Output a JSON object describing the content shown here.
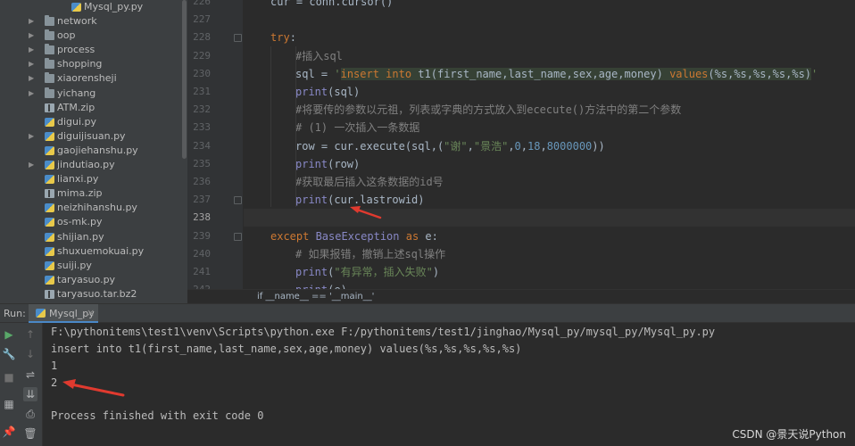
{
  "project_tree": {
    "top_item": "Mysql_py.py",
    "items": [
      {
        "label": "network",
        "type": "folder",
        "expandable": true
      },
      {
        "label": "oop",
        "type": "folder",
        "expandable": true
      },
      {
        "label": "process",
        "type": "folder",
        "expandable": true
      },
      {
        "label": "shopping",
        "type": "folder",
        "expandable": true
      },
      {
        "label": "xiaorensheji",
        "type": "folder",
        "expandable": true
      },
      {
        "label": "yichang",
        "type": "folder",
        "expandable": true
      },
      {
        "label": "ATM.zip",
        "type": "zip",
        "expandable": false
      },
      {
        "label": "digui.py",
        "type": "py",
        "expandable": false
      },
      {
        "label": "diguijisuan.py",
        "type": "py",
        "expandable": true
      },
      {
        "label": "gaojiehanshu.py",
        "type": "py",
        "expandable": false
      },
      {
        "label": "jindutiao.py",
        "type": "py",
        "expandable": true
      },
      {
        "label": "lianxi.py",
        "type": "py",
        "expandable": false
      },
      {
        "label": "mima.zip",
        "type": "zip",
        "expandable": false
      },
      {
        "label": "neizhihanshu.py",
        "type": "py",
        "expandable": false
      },
      {
        "label": "os-mk.py",
        "type": "py",
        "expandable": false
      },
      {
        "label": "shijian.py",
        "type": "py",
        "expandable": false
      },
      {
        "label": "shuxuemokuai.py",
        "type": "py",
        "expandable": false
      },
      {
        "label": "suiji.py",
        "type": "py",
        "expandable": false
      },
      {
        "label": "taryasuo.py",
        "type": "py",
        "expandable": false
      },
      {
        "label": "taryasuo.tar.bz2",
        "type": "zip",
        "expandable": false
      }
    ]
  },
  "editor": {
    "lines": [
      {
        "num": "226",
        "indent": 1,
        "tokens": [
          {
            "t": "cur = conn.cursor()",
            "c": ""
          }
        ]
      },
      {
        "num": "227",
        "indent": 0,
        "tokens": []
      },
      {
        "num": "228",
        "indent": 1,
        "fold": true,
        "tokens": [
          {
            "t": "try",
            "c": "kw"
          },
          {
            "t": ":",
            "c": ""
          }
        ]
      },
      {
        "num": "229",
        "indent": 2,
        "tokens": [
          {
            "t": "#插入sql",
            "c": "cmt"
          }
        ]
      },
      {
        "num": "230",
        "indent": 2,
        "tokens": [
          {
            "t": "sql = ",
            "c": ""
          },
          {
            "t": "'",
            "c": "str"
          },
          {
            "t": "insert into",
            "c": "sqlkw sqlbg"
          },
          {
            "t": " t1(first_name,last_name,sex,age,money) ",
            "c": "sqlbg"
          },
          {
            "t": "values",
            "c": "sqlkw sqlbg"
          },
          {
            "t": "(%s,%s,%s,%s,%s)",
            "c": "sqlbg"
          },
          {
            "t": "'",
            "c": "str"
          }
        ]
      },
      {
        "num": "231",
        "indent": 2,
        "tokens": [
          {
            "t": "print",
            "c": "fn"
          },
          {
            "t": "(sql)",
            "c": ""
          }
        ]
      },
      {
        "num": "232",
        "indent": 2,
        "tokens": [
          {
            "t": "#将要传的参数以元祖，列表或字典的方式放入到ececute()方法中的第二个参数",
            "c": "cmt"
          }
        ]
      },
      {
        "num": "233",
        "indent": 2,
        "tokens": [
          {
            "t": "# (1) 一次插入一条数据",
            "c": "cmt"
          }
        ]
      },
      {
        "num": "234",
        "indent": 2,
        "tokens": [
          {
            "t": "row = cur.execute(sql,(",
            "c": ""
          },
          {
            "t": "\"谢\"",
            "c": "str"
          },
          {
            "t": ",",
            "c": ""
          },
          {
            "t": "\"景浩\"",
            "c": "str"
          },
          {
            "t": ",",
            "c": ""
          },
          {
            "t": "0",
            "c": "num"
          },
          {
            "t": ",",
            "c": ""
          },
          {
            "t": "18",
            "c": "num"
          },
          {
            "t": ",",
            "c": ""
          },
          {
            "t": "8000000",
            "c": "num"
          },
          {
            "t": "))",
            "c": ""
          }
        ]
      },
      {
        "num": "235",
        "indent": 2,
        "tokens": [
          {
            "t": "print",
            "c": "fn"
          },
          {
            "t": "(row)",
            "c": ""
          }
        ]
      },
      {
        "num": "236",
        "indent": 2,
        "tokens": [
          {
            "t": "#获取最后插入这条数据的id号",
            "c": "cmt"
          }
        ]
      },
      {
        "num": "237",
        "indent": 2,
        "fold": true,
        "tokens": [
          {
            "t": "print",
            "c": "fn"
          },
          {
            "t": "(cur.lastrowid)",
            "c": ""
          }
        ]
      },
      {
        "num": "238",
        "indent": 0,
        "current": true,
        "tokens": []
      },
      {
        "num": "239",
        "indent": 1,
        "fold": true,
        "tokens": [
          {
            "t": "except ",
            "c": "kw"
          },
          {
            "t": "BaseException",
            "c": "fn"
          },
          {
            "t": " as ",
            "c": "kw"
          },
          {
            "t": "e:",
            "c": ""
          }
        ]
      },
      {
        "num": "240",
        "indent": 2,
        "tokens": [
          {
            "t": "# 如果报错，撤销上述sql操作",
            "c": "cmt"
          }
        ]
      },
      {
        "num": "241",
        "indent": 2,
        "tokens": [
          {
            "t": "print",
            "c": "fn"
          },
          {
            "t": "(",
            "c": ""
          },
          {
            "t": "\"有异常，插入失败\"",
            "c": "str"
          },
          {
            "t": ")",
            "c": ""
          }
        ]
      },
      {
        "num": "242",
        "indent": 2,
        "tokens": [
          {
            "t": "print",
            "c": "fn"
          },
          {
            "t": "(e)",
            "c": ""
          }
        ]
      }
    ],
    "breadcrumb": "if __name__ == '__main__'"
  },
  "run_panel": {
    "label": "Run:",
    "tab": "Mysql_py",
    "output": [
      "F:\\pythonitems\\test1\\venv\\Scripts\\python.exe F:/pythonitems/test1/jinghao/Mysql_py/mysql_py/Mysql_py.py",
      "insert into t1(first_name,last_name,sex,age,money) values(%s,%s,%s,%s,%s)",
      "1",
      "2",
      "",
      "Process finished with exit code 0"
    ]
  },
  "watermark": "CSDN @景天说Python",
  "colors": {
    "accent": "#4a88c7",
    "arrow": "#e03a2f"
  }
}
